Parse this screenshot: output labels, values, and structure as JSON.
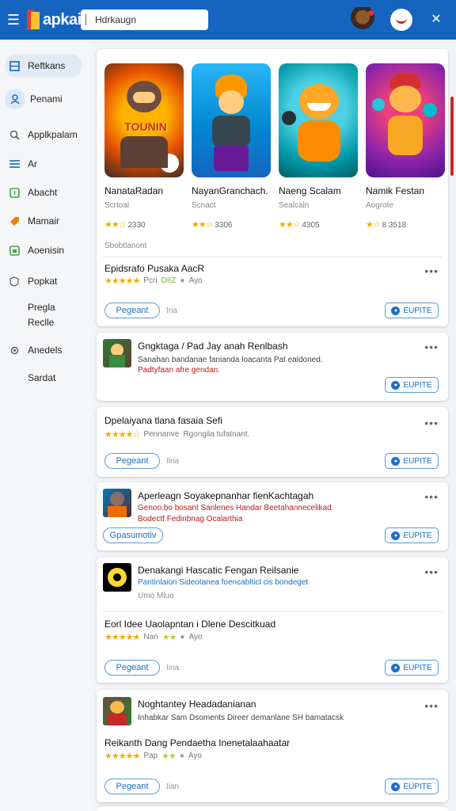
{
  "header": {
    "logo_text": "apkai",
    "search_value": "Hdrkaugn",
    "menu_icon": "hamburger-icon",
    "close_icon": "close-icon"
  },
  "sidebar": {
    "items": [
      {
        "label": "Reftkans",
        "icon": "grid-icon"
      },
      {
        "label": "Penami",
        "icon": "person-icon"
      },
      {
        "label": "Applkpalam",
        "icon": "search-icon"
      },
      {
        "label": "Ar",
        "icon": "list-icon"
      },
      {
        "label": "Abacht",
        "icon": "upload-icon"
      },
      {
        "label": "Mamair",
        "icon": "tag-icon"
      },
      {
        "label": "Aoenisin",
        "icon": "image-icon"
      },
      {
        "label": "Popkat",
        "icon": "shield-icon"
      },
      {
        "label": "Pregla",
        "icon": ""
      },
      {
        "label": "Reclle",
        "icon": ""
      },
      {
        "label": "Anedels",
        "icon": "gear-icon"
      },
      {
        "label": "Sardat",
        "icon": ""
      }
    ]
  },
  "featured": {
    "games": [
      {
        "title": "NanataRadan",
        "subtitle": "Scrtoal",
        "rating": "2330",
        "art_label": "TOUNIN"
      },
      {
        "title": "NayanGranchach.",
        "subtitle": "Scnact",
        "rating": "3306",
        "art_label": ""
      },
      {
        "title": "Naeng Scalam",
        "subtitle": "Sealcaln",
        "rating": "4305",
        "art_label": ""
      },
      {
        "title": "Namik Festan",
        "subtitle": "Aogrote",
        "rating": "8 3518",
        "art_label": ""
      }
    ],
    "footer_label": "Sbobtlanont"
  },
  "apps": [
    {
      "title": "Epidsrafo Pusaka AacR",
      "meta_left": "Pcri",
      "meta_mid": "DIIZ",
      "meta_right": "Ayo",
      "pill": "Pegeant",
      "after": "Iria",
      "action": "EUPITE"
    },
    {
      "title": "Gngktaga / Pad Jay anah Renlbash",
      "desc1": "Sanahan bandanae fanianda loacanta Pat ealdoned.",
      "desc2": "Padtyfaan afre gendan.",
      "action": "EUPITE"
    },
    {
      "title": "Dpelaiyana tlana fasaia Sefi",
      "meta_left": "Pennanve",
      "meta_right": "Rgongila tufatnant.",
      "pill": "Pegeant",
      "after": "Ilria",
      "action": "EUPITE"
    },
    {
      "title": "Aperleagn Soyakepnanhar fienKachtagah",
      "desc1": "Genoo.bo bosant Sanlenes Handar Beetahannecelikad.",
      "desc2": "Bodectf Fedinbnag Ocalarthia",
      "pill": "Gpasumotiv",
      "action": "EUPITE"
    },
    {
      "title": "Denakangi Hascatic Fengan Reilsanie",
      "desc1": "Pantinlaion Sideotanea foencablticl cis bondeget",
      "desc2": "Umo Mluo",
      "sub_title": "Eorl Idee Uaolapntan i Dlene Descitkuad",
      "meta_left": "Nan",
      "meta_right": "Ayo",
      "pill": "Pegeant",
      "after": "Iina",
      "action": "EUPITE"
    },
    {
      "title": "Noghtantey Headadanianan",
      "desc1": "Inhabkar Sam Dsoments Direer demanlane SH bamatacsk",
      "sub_title": "Reikanth Dang Pendaetha Inenetalaahaatar",
      "meta_left": "Pap",
      "meta_right": "Ayo",
      "pill": "Pegeant",
      "after": "Iian",
      "action": "EUPITE"
    }
  ],
  "colors": {
    "accent": "#1565c0",
    "star": "#f2a900",
    "link": "#1f6fc2",
    "warn": "#b71c1c"
  }
}
